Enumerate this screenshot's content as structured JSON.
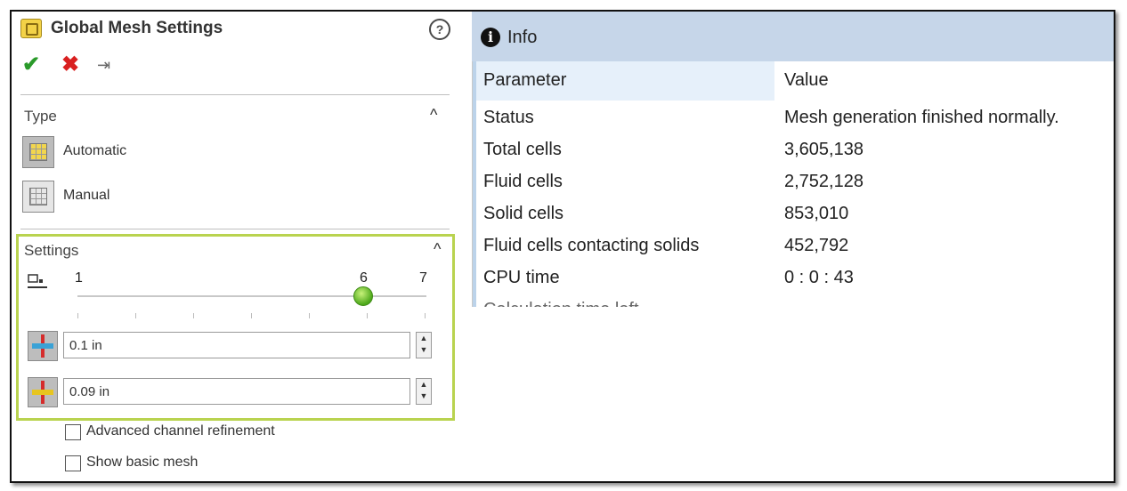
{
  "panel": {
    "title": "Global Mesh Settings",
    "help_icon": "question-circle-icon",
    "help_glyph": "?",
    "actions": {
      "ok": "✔",
      "cancel": "✖",
      "pin": "⇥"
    },
    "type_section": {
      "title": "Type",
      "chevron": "^",
      "options": [
        {
          "label": "Automatic",
          "active": true
        },
        {
          "label": "Manual",
          "active": false
        }
      ]
    },
    "settings_section": {
      "title": "Settings",
      "chevron": "^",
      "slider": {
        "min": "1",
        "value": "6",
        "max": "7"
      },
      "min_cell_size": "0.1 in",
      "min_gap_size": "0.09 in",
      "spin_up": "▲",
      "spin_down": "▼"
    },
    "checkboxes": [
      {
        "label": "Advanced channel refinement",
        "checked": false
      },
      {
        "label": "Show basic mesh",
        "checked": false
      }
    ]
  },
  "info": {
    "title": "Info",
    "icon_glyph": "i",
    "headers": {
      "param": "Parameter",
      "value": "Value"
    },
    "rows": [
      {
        "param": "Status",
        "value": "Mesh generation finished normally."
      },
      {
        "param": "Total cells",
        "value": "3,605,138"
      },
      {
        "param": "Fluid cells",
        "value": "2,752,128"
      },
      {
        "param": "Solid cells",
        "value": "853,010"
      },
      {
        "param": "Fluid cells contacting solids",
        "value": "452,792"
      },
      {
        "param": "CPU time",
        "value": "0 : 0 : 43"
      },
      {
        "param": "Calculation time left",
        "value": ""
      }
    ]
  },
  "colors": {
    "accent_green": "#b9d34f",
    "ok_green": "#2a9a2a",
    "cancel_red": "#d92020",
    "info_header_bg": "#c6d6e9"
  }
}
